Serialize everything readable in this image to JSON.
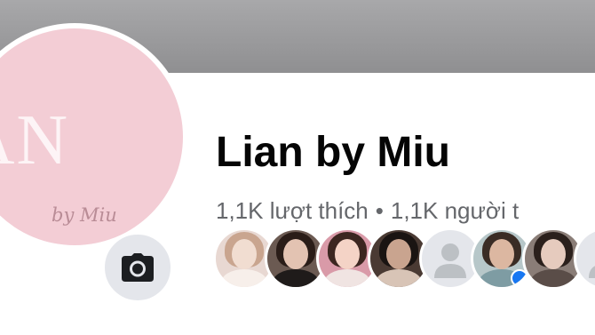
{
  "page": {
    "name": "Lian by Miu",
    "likes": "1,1K lượt thích",
    "separator": "•",
    "followers": "1,1K người t"
  },
  "avatar": {
    "logo_text": "IAN",
    "logo_subtext": "by Miu",
    "background": "#f3cdd5"
  },
  "camera_button": {
    "icon": "camera-icon"
  },
  "friends": [
    {
      "icon": "friend-avatar-photo"
    },
    {
      "icon": "friend-avatar-photo"
    },
    {
      "icon": "friend-avatar-photo"
    },
    {
      "icon": "friend-avatar-photo"
    },
    {
      "icon": "default-avatar-icon"
    },
    {
      "icon": "friend-avatar-photo",
      "verified": true
    },
    {
      "icon": "friend-avatar-photo"
    },
    {
      "icon": "default-avatar-icon"
    }
  ],
  "colors": {
    "cover": "#999999",
    "name": "#050505",
    "secondary_text": "#65676b",
    "badge": "#1877f2"
  }
}
